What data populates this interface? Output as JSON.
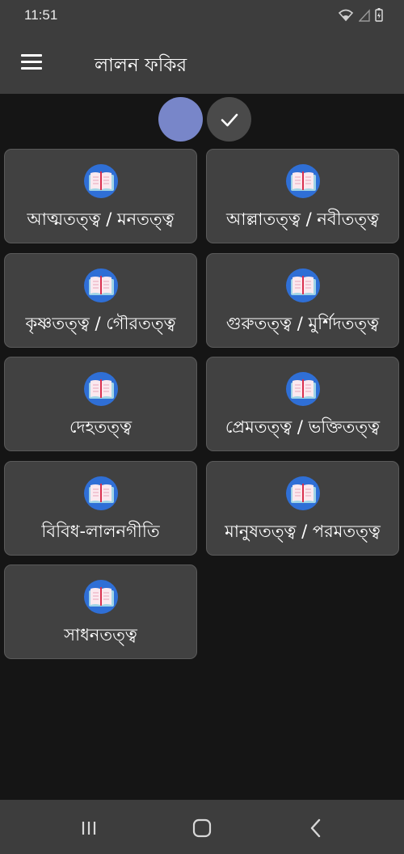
{
  "status": {
    "time": "11:51"
  },
  "app_bar": {
    "title": "লালন ফকির"
  },
  "theme": {
    "selected_color": "#7886c9"
  },
  "categories": [
    {
      "label": "আত্মতত্ত্ব / মনতত্ত্ব"
    },
    {
      "label": "আল্লাতত্ত্ব / নবীতত্ত্ব"
    },
    {
      "label": "কৃষ্ণতত্ত্ব / গৌরতত্ত্ব"
    },
    {
      "label": "গুরুতত্ত্ব / মুর্শিদতত্ত্ব"
    },
    {
      "label": "দেহতত্ত্ব"
    },
    {
      "label": "প্রেমতত্ত্ব / ভক্তিতত্ত্ব"
    },
    {
      "label": "বিবিধ-লালনগীতি"
    },
    {
      "label": "মানুষতত্ত্ব / পরমতত্ত্ব"
    },
    {
      "label": "সাধনতত্ত্ব"
    }
  ],
  "icons": {
    "menu": "menu-icon",
    "check": "check-icon",
    "book": "book-icon",
    "wifi": "wifi-icon",
    "signal": "signal-icon",
    "battery": "battery-icon",
    "recents": "recents-icon",
    "home": "home-icon",
    "back": "back-icon"
  }
}
